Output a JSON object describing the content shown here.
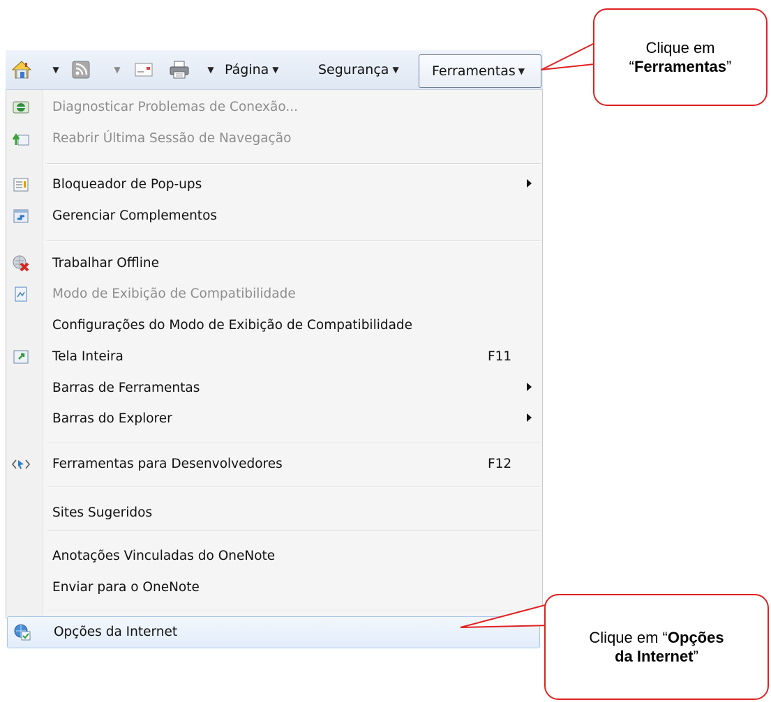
{
  "toolbar": {
    "home_icon": "home-icon",
    "feeds_icon": "feeds-icon",
    "mail_icon": "read-mail-icon",
    "print_icon": "print-icon",
    "page_label": "Página",
    "safety_label": "Segurança",
    "tools_label": "Ferramentas"
  },
  "menu": {
    "items": [
      {
        "label": "Diagnosticar Problemas de Conexão...",
        "icon": "diagnose-icon",
        "disabled": true
      },
      {
        "label": "Reabrir Última Sessão de Navegação",
        "icon": "reopen-session-icon",
        "disabled": true
      },
      {
        "label": "Bloqueador de Pop-ups",
        "icon": "popup-blocker-icon",
        "submenu": true
      },
      {
        "label": "Gerenciar Complementos",
        "icon": "manage-addons-icon"
      },
      {
        "label": "Trabalhar Offline",
        "icon": "work-offline-icon"
      },
      {
        "label": "Modo de Exibição de Compatibilidade",
        "icon": "compatibility-view-icon",
        "disabled": true
      },
      {
        "label": "Configurações do Modo de Exibição de Compatibilidade"
      },
      {
        "label": "Tela Inteira",
        "icon": "fullscreen-icon",
        "shortcut": "F11"
      },
      {
        "label": "Barras de Ferramentas",
        "submenu": true
      },
      {
        "label": "Barras do Explorer",
        "submenu": true
      },
      {
        "label": "Ferramentas para Desenvolvedores",
        "icon": "developer-tools-icon",
        "shortcut": "F12"
      },
      {
        "label": "Sites Sugeridos"
      },
      {
        "label": "Anotações Vinculadas do OneNote"
      },
      {
        "label": "Enviar para o OneNote"
      },
      {
        "label": "Opções da Internet",
        "icon": "internet-options-icon",
        "selected": true
      }
    ]
  },
  "callouts": {
    "tools": {
      "line1": "Clique em",
      "prefix": "“",
      "bold": "Ferramentas",
      "suffix": "”"
    },
    "options": {
      "prefix": "Clique em “",
      "bold1": "Opções",
      "bold2": "da Internet",
      "suffix": "”"
    }
  },
  "colors": {
    "callout_border": "#e02020",
    "menu_bg": "#f5f5f5",
    "selected_bg": "#e2edfa"
  }
}
